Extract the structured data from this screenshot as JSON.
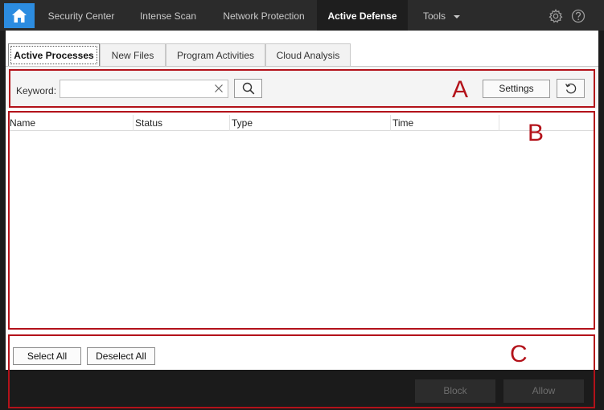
{
  "nav": {
    "items": [
      "Security Center",
      "Intense Scan",
      "Network Protection",
      "Active Defense",
      "Tools"
    ],
    "active": "Active Defense",
    "icons": [
      "home-icon",
      "gear-icon",
      "help-icon"
    ]
  },
  "tabs": {
    "items": [
      "Active Processes",
      "New Files",
      "Program Activities",
      "Cloud Analysis"
    ],
    "active": "Active Processes"
  },
  "filter": {
    "keyword_label": "Keyword:",
    "keyword_value": "",
    "settings_label": "Settings"
  },
  "table": {
    "columns": [
      "Name",
      "Status",
      "Type",
      "Time"
    ],
    "rows": []
  },
  "actions": {
    "select_all": "Select All",
    "deselect_all": "Deselect All",
    "block": "Block",
    "allow": "Allow"
  },
  "annotations": {
    "labels": [
      "A",
      "B",
      "C"
    ],
    "color": "#b3121a"
  },
  "colors": {
    "accent": "#2c8ce0",
    "topbar": "#2b2b2b",
    "footer": "#1b1b1b"
  }
}
